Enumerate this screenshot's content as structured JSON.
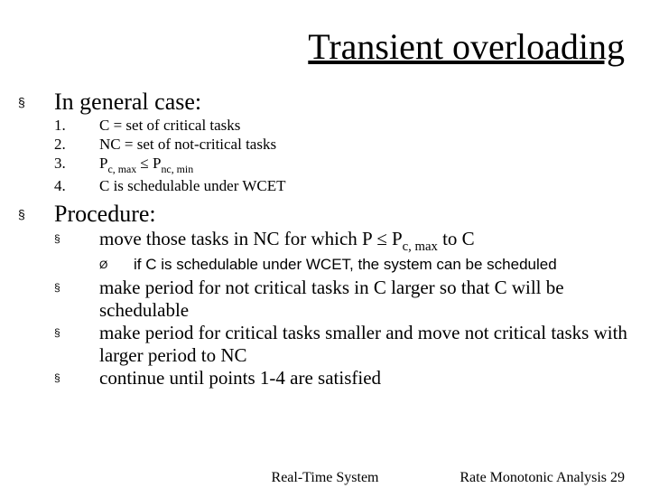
{
  "title": "Transient overloading",
  "bullet_square": "§",
  "bullet_tri": "Ø",
  "sections": {
    "general": {
      "heading": "In general case:",
      "items": [
        {
          "num": "1.",
          "text": "C = set of critical tasks"
        },
        {
          "num": "2.",
          "text": "NC = set of not-critical tasks"
        },
        {
          "num": "3.",
          "pre": "P",
          "sub1": "c, max",
          "mid": " ≤ P",
          "sub2": "nc, min"
        },
        {
          "num": "4.",
          "text": "C is schedulable under WCET"
        }
      ]
    },
    "procedure": {
      "heading": "Procedure:",
      "items": [
        {
          "pre": "move those tasks in NC for which P ≤ P",
          "sub": "c, max",
          "post": " to C",
          "sub_items": [
            "if C is schedulable under WCET, the system can be scheduled"
          ]
        },
        {
          "text": "make period for not critical tasks in C larger so that C will be schedulable"
        },
        {
          "text": "make period for critical tasks smaller and move not critical tasks with larger period to NC"
        },
        {
          "text": "continue until points 1-4 are satisfied"
        }
      ]
    }
  },
  "footer": {
    "center": "Real-Time System",
    "right": "Rate Monotonic Analysis 29"
  }
}
